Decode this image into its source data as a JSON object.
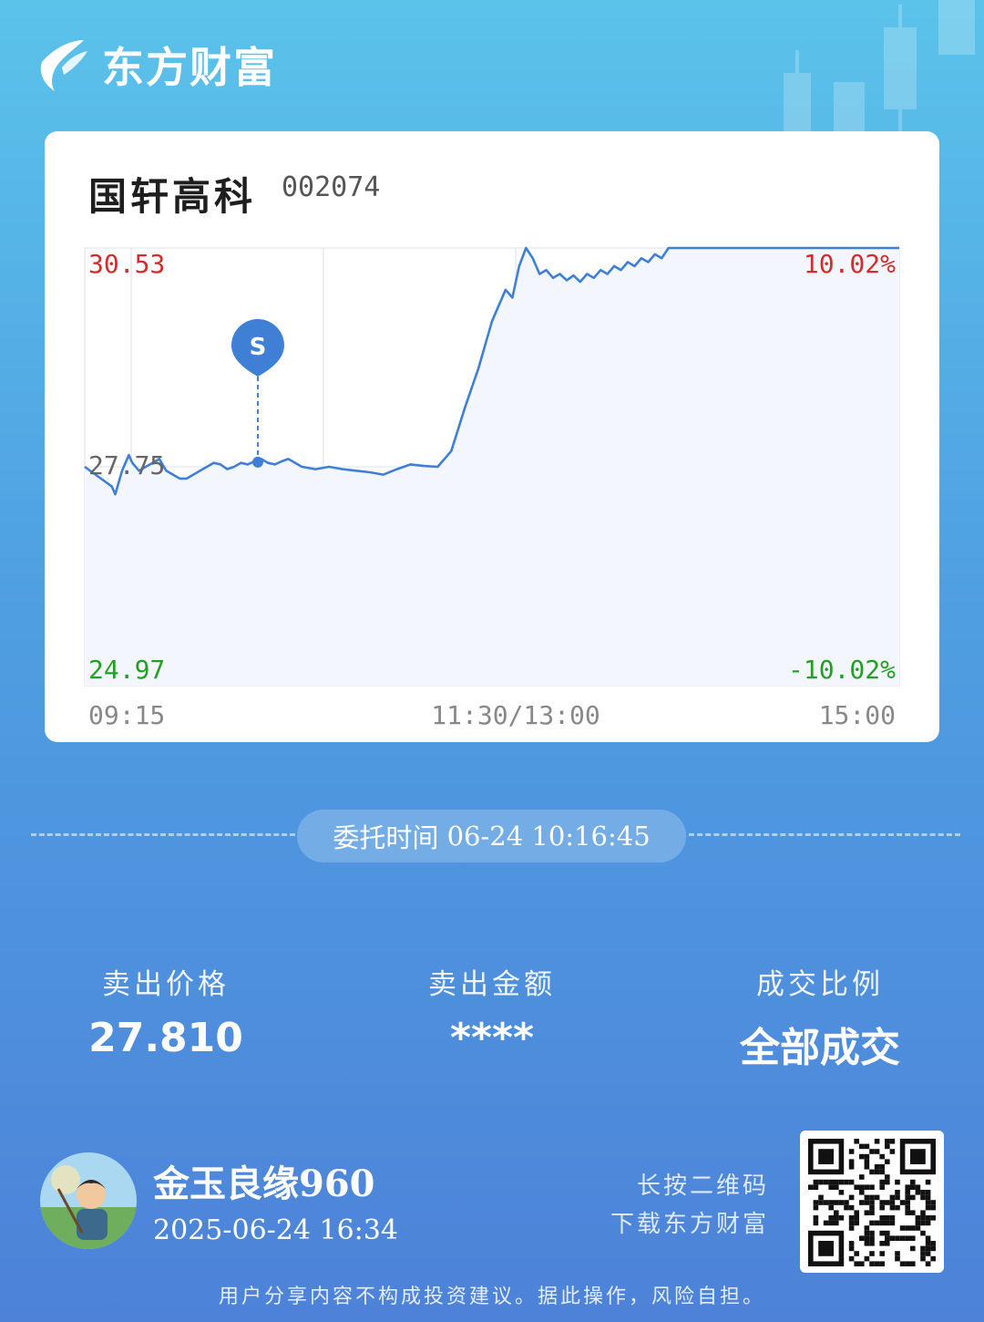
{
  "brand": {
    "name": "东方财富",
    "logo_icon": "eastmoney-logo-icon"
  },
  "stock": {
    "name": "国轩高科",
    "code": "002074"
  },
  "chart_data": {
    "type": "line",
    "ylim": [
      24.97,
      30.53
    ],
    "y_reference": 27.75,
    "y_labels": {
      "high": "30.53",
      "mid": "27.75",
      "low": "24.97"
    },
    "pct_labels": {
      "high": "10.02%",
      "low": "-10.02%"
    },
    "x_labels": {
      "start": "09:15",
      "mid": "11:30/13:00",
      "end": "15:00"
    },
    "x_range": [
      0,
      240
    ],
    "sell_marker": {
      "label": "S",
      "x": 51,
      "y": 27.81
    },
    "series": [
      {
        "x": [
          0,
          8,
          9,
          11,
          13,
          14,
          16,
          18,
          20,
          22,
          24,
          26,
          28,
          30,
          32,
          34,
          36,
          38,
          40,
          42,
          44,
          46,
          48,
          50,
          52,
          54,
          56,
          58,
          60,
          64,
          68,
          72,
          76,
          80,
          84,
          88,
          92,
          96,
          100,
          104,
          108,
          112,
          116,
          120,
          124,
          126,
          128,
          130,
          132,
          134,
          136,
          138,
          140,
          142,
          144,
          146,
          148,
          150,
          152,
          154,
          156,
          158,
          160,
          162,
          164,
          166,
          168,
          170,
          172,
          175,
          240
        ],
        "y": [
          27.75,
          27.5,
          27.4,
          27.7,
          27.9,
          27.8,
          27.7,
          27.75,
          27.8,
          27.85,
          27.7,
          27.65,
          27.6,
          27.6,
          27.65,
          27.7,
          27.75,
          27.8,
          27.78,
          27.72,
          27.75,
          27.8,
          27.78,
          27.82,
          27.85,
          27.8,
          27.78,
          27.82,
          27.85,
          27.75,
          27.72,
          27.75,
          27.72,
          27.7,
          27.68,
          27.65,
          27.72,
          27.78,
          27.76,
          27.75,
          27.95,
          28.5,
          29.0,
          29.6,
          30.0,
          29.9,
          30.3,
          30.53,
          30.4,
          30.2,
          30.25,
          30.15,
          30.2,
          30.12,
          30.18,
          30.1,
          30.2,
          30.15,
          30.25,
          30.2,
          30.3,
          30.25,
          30.35,
          30.3,
          30.4,
          30.35,
          30.45,
          30.4,
          30.53,
          30.53,
          30.53
        ]
      }
    ]
  },
  "order": {
    "label": "委托时间",
    "time": "06-24 10:16:45"
  },
  "stats": [
    {
      "label": "卖出价格",
      "value": "27.810"
    },
    {
      "label": "卖出金额",
      "value": "****"
    },
    {
      "label": "成交比例",
      "value": "全部成交"
    }
  ],
  "user": {
    "name": "金玉良缘960",
    "time": "2025-06-24 16:34",
    "avatar_icon": "avatar-icon"
  },
  "qr": {
    "hint_line1": "长按二维码",
    "hint_line2": "下载东方财富",
    "icon": "qr-code-icon"
  },
  "disclaimer": "用户分享内容不构成投资建议。据此操作，风险自担。",
  "colors": {
    "up": "#d42b2b",
    "down": "#23a023",
    "line": "#3f7fd6",
    "neutral": "#666666"
  }
}
